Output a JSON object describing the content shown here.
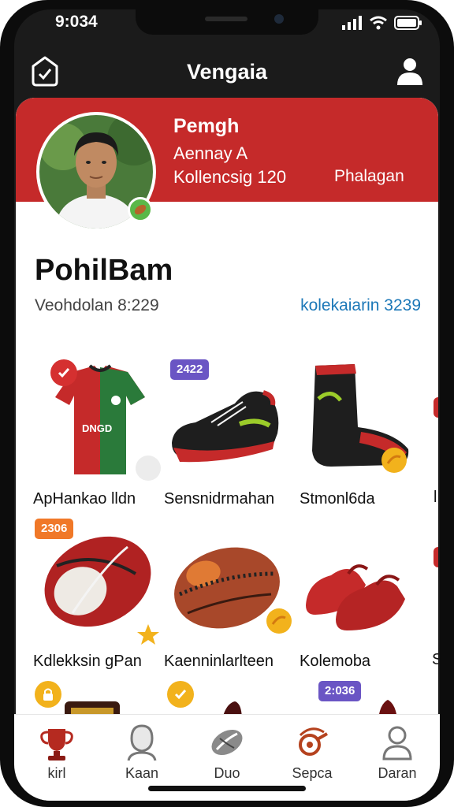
{
  "status": {
    "time": "9:034"
  },
  "header": {
    "title": "Vengaia"
  },
  "profile": {
    "name": "Pemgh",
    "subtitle": "Aennay A",
    "stat": "Kollencsig 120",
    "link": "Phalagan"
  },
  "user": {
    "name": "PohilBam",
    "meta": "Veohdolan 8:229",
    "collection": "kolekaiarin 3239"
  },
  "items": [
    {
      "label": "ApHankao lldn",
      "badge": ""
    },
    {
      "label": "Sensnidrmahan",
      "badge": "2422"
    },
    {
      "label": "Stmonl6da",
      "badge": ""
    },
    {
      "label": "Kdlekksin gPan",
      "badge": "2306"
    },
    {
      "label": "Kaenninlarlteen",
      "badge": ""
    },
    {
      "label": "Kolemoba",
      "badge": ""
    },
    {
      "label": "",
      "badge": ""
    },
    {
      "label": "",
      "badge": ""
    },
    {
      "label": "",
      "badge": "2:036"
    }
  ],
  "peek_labels": [
    "l",
    "S"
  ],
  "nav": [
    {
      "label": "kirl",
      "icon": "trophy-icon"
    },
    {
      "label": "Kaan",
      "icon": "person-icon"
    },
    {
      "label": "Duo",
      "icon": "ball-icon"
    },
    {
      "label": "Sepca",
      "icon": "whistle-icon"
    },
    {
      "label": "Daran",
      "icon": "profile-icon"
    }
  ],
  "colors": {
    "brand_red": "#c52a2a",
    "link_blue": "#1c78b8",
    "accent_yellow": "#f2b21c",
    "accent_purple": "#6a55c4",
    "accent_orange": "#f07828"
  }
}
